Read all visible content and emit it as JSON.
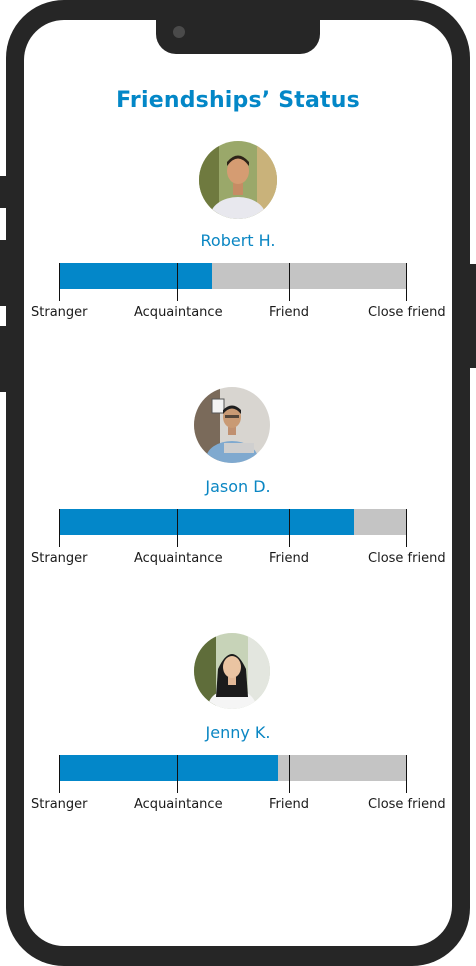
{
  "app": {
    "title": "Friendships’ Status"
  },
  "scale_labels": [
    "Stranger",
    "Acquaintance",
    "Friend",
    "Close friend"
  ],
  "friends": [
    {
      "name": "Robert H.",
      "progress_percent": 44,
      "avatar": "person-avatar-robert"
    },
    {
      "name": "Jason D.",
      "progress_percent": 85,
      "avatar": "person-avatar-jason"
    },
    {
      "name": "Jenny K.",
      "progress_percent": 63,
      "avatar": "person-avatar-jenny"
    }
  ],
  "colors": {
    "accent": "#0387c7",
    "bar_bg": "#c4c4c4",
    "frame": "#262626"
  }
}
